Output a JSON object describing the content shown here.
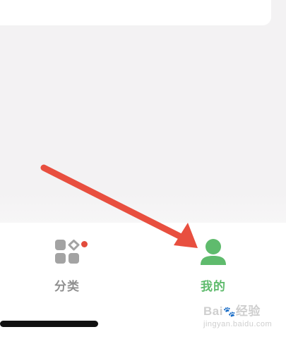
{
  "tabbar": {
    "category_label": "分类",
    "mine_label": "我的"
  },
  "watermark": {
    "brand_left": "Bai",
    "brand_paw": "🐾",
    "brand_right": "经验",
    "sub": "jingyan.baidu.com"
  },
  "colors": {
    "active": "#5fbb6d",
    "inactive": "#8f8f8f",
    "badge": "#e24b3c",
    "arrow": "#e84f3f"
  },
  "icons": {
    "category": "grid-category-icon",
    "mine": "person-icon",
    "arrow": "red-arrow-annotation"
  }
}
